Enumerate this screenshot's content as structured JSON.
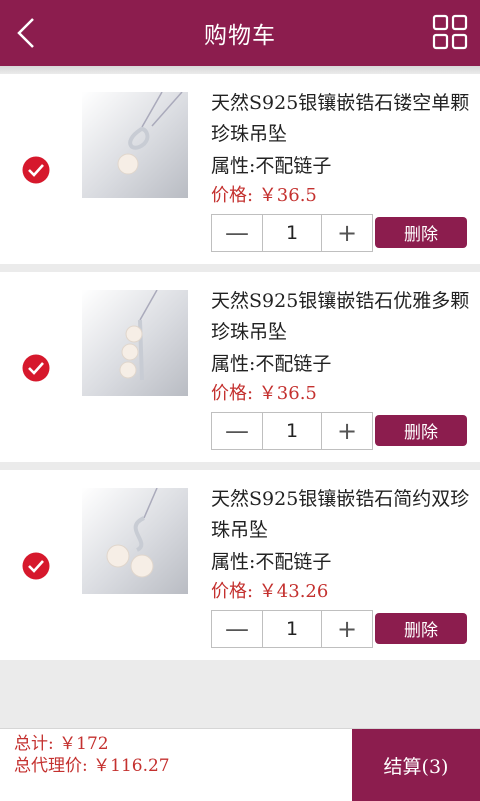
{
  "header": {
    "title": "购物车",
    "back_icon": "chevron-left-icon",
    "menu_icon": "grid-icon"
  },
  "items": [
    {
      "name": "天然S925银镶嵌锆石镂空单颗珍珠吊坠",
      "attr": "属性:不配链子",
      "price": "价格: ￥36.5",
      "quantity": "1",
      "minus": "—",
      "plus": "+",
      "delete_label": "删除",
      "checked": true
    },
    {
      "name": "天然S925银镶嵌锆石优雅多颗珍珠吊坠",
      "attr": "属性:不配链子",
      "price": "价格: ￥36.5",
      "quantity": "1",
      "minus": "—",
      "plus": "+",
      "delete_label": "删除",
      "checked": true
    },
    {
      "name": "天然S925银镶嵌锆石简约双珍珠吊坠",
      "attr": "属性:不配链子",
      "price": "价格: ￥43.26",
      "quantity": "1",
      "minus": "—",
      "plus": "+",
      "delete_label": "删除",
      "checked": true
    }
  ],
  "footer": {
    "total": "总计: ￥172",
    "agent_total": "总代理价: ￥116.27",
    "checkout_label": "结算(3)"
  },
  "colors": {
    "brand": "#8c1d4e",
    "price": "#c4312f",
    "check": "#d6182c"
  }
}
